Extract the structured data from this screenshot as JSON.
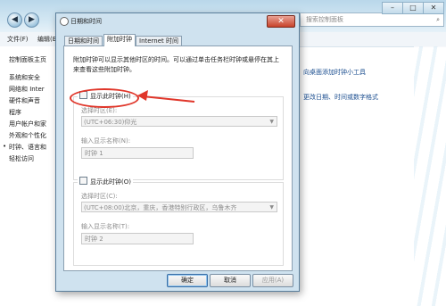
{
  "background_window": {
    "search_placeholder": "搜索控制面板",
    "menu": [
      "文件(F)",
      "编辑(E)"
    ],
    "sidebar": [
      {
        "label": "控制面板主页",
        "active": false
      },
      {
        "label": "系统和安全",
        "active": false
      },
      {
        "label": "网络和 Inter",
        "active": false
      },
      {
        "label": "硬件和声音",
        "active": false
      },
      {
        "label": "程序",
        "active": false
      },
      {
        "label": "用户帐户和家",
        "active": false
      },
      {
        "label": "外观和个性化",
        "active": false
      },
      {
        "label": "时钟、语言和",
        "active": true
      },
      {
        "label": "轻松访问",
        "active": false
      }
    ],
    "links": [
      "向桌面添加时钟小工具",
      "更改日期、时间或数字格式"
    ]
  },
  "dialog": {
    "title": "日期和时间",
    "close_glyph": "✕",
    "tabs": [
      {
        "label": "日期和时间",
        "selected": false
      },
      {
        "label": "附加时钟",
        "selected": true
      },
      {
        "label": "Internet 时间",
        "selected": false
      }
    ],
    "description": "附加时钟可以显示其他时区的时间。可以通过单击任务栏时钟或悬停在其上来查看这些附加时钟。",
    "clock1": {
      "checkbox_label": "显示此时钟(H)",
      "checked": false,
      "timezone_label": "选择时区(E):",
      "timezone_value": "(UTC+06:30)仰光",
      "name_label": "输入显示名称(N):",
      "name_value": "时钟 1"
    },
    "clock2": {
      "checkbox_label": "显示此时钟(O)",
      "checked": false,
      "timezone_label": "选择时区(C):",
      "timezone_value": "(UTC+08:00)北京，重庆，香港特别行政区，乌鲁木齐",
      "name_label": "输入显示名称(T):",
      "name_value": "时钟 2"
    },
    "buttons": {
      "ok": "确定",
      "cancel": "取消",
      "apply": "应用(A)"
    }
  },
  "colors": {
    "annotation": "#e0362a",
    "link": "#1a4d8f"
  }
}
